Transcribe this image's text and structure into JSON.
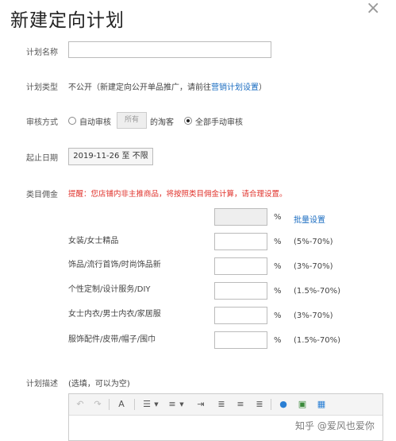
{
  "dialog": {
    "title": "新建定向计划",
    "close_glyph": "×"
  },
  "plan_name": {
    "label": "计划名称",
    "value": "",
    "placeholder": ""
  },
  "plan_type": {
    "label": "计划类型",
    "text": "不公开（新建定向公开单品推广，请前往",
    "link": "营销计划设置",
    "suffix": "）"
  },
  "review": {
    "label": "审核方式",
    "auto_label": "自动审核",
    "auto_select_value": "所有",
    "auto_suffix": "的淘客",
    "manual_label": "全部手动审核",
    "selected": "manual"
  },
  "date": {
    "label": "起止日期",
    "value": "2019-11-26 至 不限"
  },
  "commission": {
    "label": "类目佣金",
    "warning": "提醒：您店铺内非主推商品，将按照类目佣金计算，请合理设置。",
    "batch": {
      "value": "",
      "percent": "%",
      "link": "批量设置"
    },
    "categories": [
      {
        "name": "女装/女士精品",
        "value": "",
        "percent": "%",
        "range": "(5%-70%)"
      },
      {
        "name": "饰品/流行首饰/时尚饰品新",
        "value": "",
        "percent": "%",
        "range": "(3%-70%)"
      },
      {
        "name": "个性定制/设计服务/DIY",
        "value": "",
        "percent": "%",
        "range": "(1.5%-70%)"
      },
      {
        "name": "女士内衣/男士内衣/家居服",
        "value": "",
        "percent": "%",
        "range": "(3%-70%)"
      },
      {
        "name": "服饰配件/皮带/帽子/围巾",
        "value": "",
        "percent": "%",
        "range": "(1.5%-70%)"
      }
    ]
  },
  "description": {
    "label": "计划描述",
    "hint": "(选填，可以为空)"
  },
  "watermark": "知乎 @爱风也爱你",
  "colors": {
    "link": "#1a6cc1",
    "warning": "#e0322b"
  }
}
